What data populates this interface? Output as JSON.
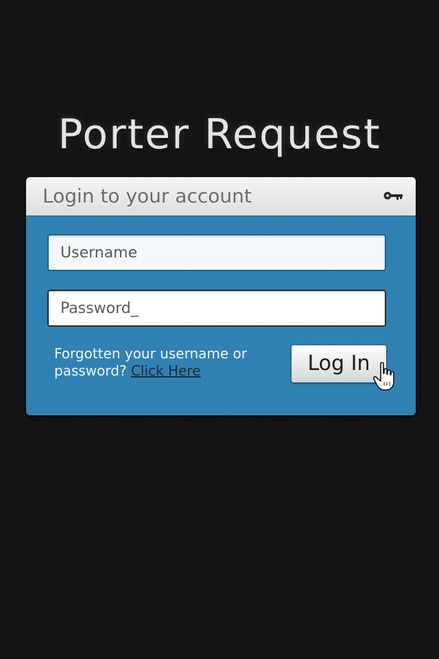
{
  "app": {
    "title": "Porter Request"
  },
  "card": {
    "header_title": "Login to your account",
    "header_icon": "key-icon"
  },
  "form": {
    "username_placeholder": "Username",
    "password_value": "Password_",
    "forgot_text": "Forgotten your username or password?",
    "forgot_link": "Click Here",
    "login_label": "Log In"
  },
  "colors": {
    "background": "#151515",
    "panel": "#2e80b3",
    "header": "#e8e8e8"
  },
  "cursor": {
    "icon": "hand-pointer-icon"
  }
}
